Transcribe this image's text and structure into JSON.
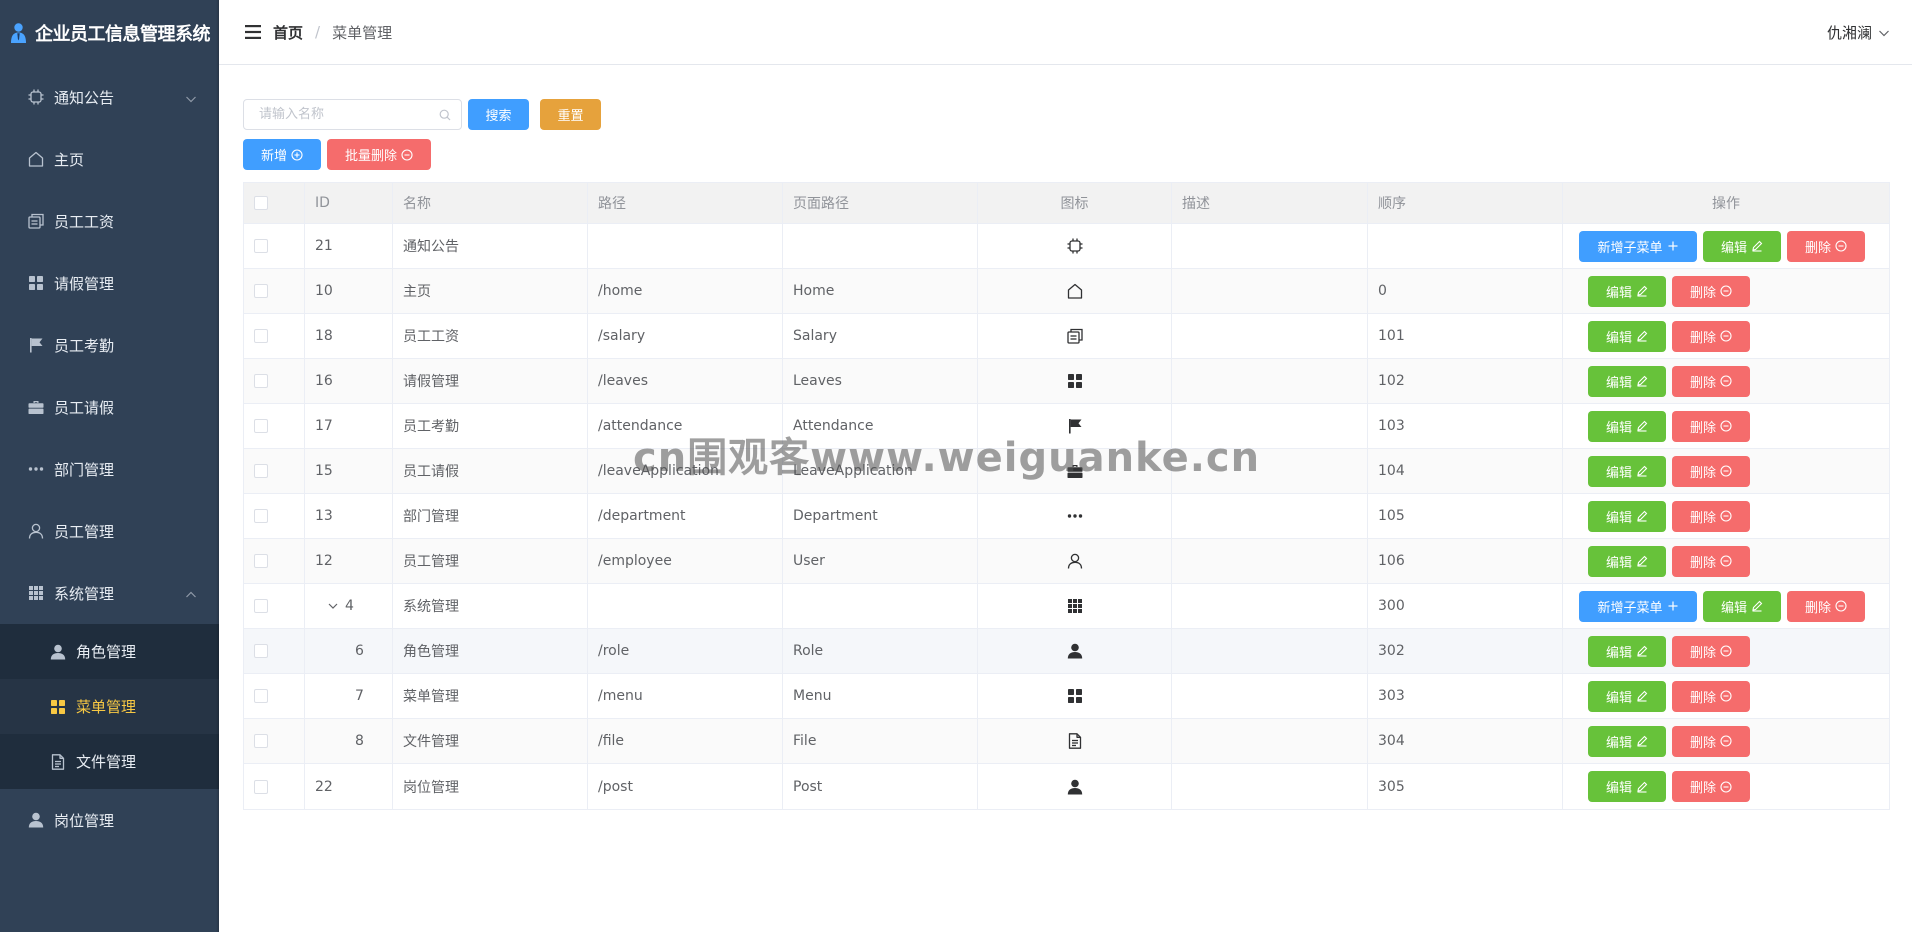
{
  "app": {
    "title": "企业员工信息管理系统"
  },
  "sidebar": {
    "items": [
      {
        "label": "通知公告",
        "icon": "cpu-icon",
        "arrow": "down"
      },
      {
        "label": "主页",
        "icon": "house-icon"
      },
      {
        "label": "员工工资",
        "icon": "tickets-icon"
      },
      {
        "label": "请假管理",
        "icon": "menu-grid-icon"
      },
      {
        "label": "员工考勤",
        "icon": "flag-icon"
      },
      {
        "label": "员工请假",
        "icon": "suitcase-icon"
      },
      {
        "label": "部门管理",
        "icon": "more-icon"
      },
      {
        "label": "员工管理",
        "icon": "user-icon"
      },
      {
        "label": "系统管理",
        "icon": "grid-icon",
        "arrow": "up"
      }
    ],
    "submenu": [
      {
        "label": "角色管理",
        "icon": "user-solid-icon"
      },
      {
        "label": "菜单管理",
        "icon": "menu-grid-icon",
        "active": true
      },
      {
        "label": "文件管理",
        "icon": "document-icon"
      }
    ],
    "last_item": {
      "label": "岗位管理",
      "icon": "user-solid-icon"
    }
  },
  "header": {
    "breadcrumb": {
      "home": "首页",
      "separator": "/",
      "current": "菜单管理"
    },
    "user": "仇湘澜"
  },
  "toolbar": {
    "search_placeholder": "请输入名称",
    "search_value": "",
    "search_label": "搜索",
    "reset_label": "重置",
    "add_label": "新增",
    "batch_delete_label": "批量删除"
  },
  "table": {
    "columns": [
      "ID",
      "名称",
      "路径",
      "页面路径",
      "图标",
      "描述",
      "顺序",
      "操作"
    ],
    "rows": [
      {
        "id": "21",
        "name": "通知公告",
        "path": "",
        "page": "",
        "icon": "cpu-icon",
        "desc": "",
        "order": "",
        "has_children": true,
        "level": 0
      },
      {
        "id": "10",
        "name": "主页",
        "path": "/home",
        "page": "Home",
        "icon": "house-icon",
        "desc": "",
        "order": "0",
        "level": 0
      },
      {
        "id": "18",
        "name": "员工工资",
        "path": "/salary",
        "page": "Salary",
        "icon": "tickets-icon",
        "desc": "",
        "order": "101",
        "level": 0
      },
      {
        "id": "16",
        "name": "请假管理",
        "path": "/leaves",
        "page": "Leaves",
        "icon": "menu-grid-icon",
        "desc": "",
        "order": "102",
        "level": 0
      },
      {
        "id": "17",
        "name": "员工考勤",
        "path": "/attendance",
        "page": "Attendance",
        "icon": "flag-icon",
        "desc": "",
        "order": "103",
        "level": 0
      },
      {
        "id": "15",
        "name": "员工请假",
        "path": "/leaveApplication",
        "page": "LeaveApplication",
        "icon": "suitcase-icon",
        "desc": "",
        "order": "104",
        "level": 0
      },
      {
        "id": "13",
        "name": "部门管理",
        "path": "/department",
        "page": "Department",
        "icon": "more-icon",
        "desc": "",
        "order": "105",
        "level": 0
      },
      {
        "id": "12",
        "name": "员工管理",
        "path": "/employee",
        "page": "User",
        "icon": "user-icon",
        "desc": "",
        "order": "106",
        "level": 0
      },
      {
        "id": "4",
        "name": "系统管理",
        "path": "",
        "page": "",
        "icon": "grid-icon",
        "desc": "",
        "order": "300",
        "has_children": true,
        "expanded": true,
        "level": 0
      },
      {
        "id": "6",
        "name": "角色管理",
        "path": "/role",
        "page": "Role",
        "icon": "user-solid-icon",
        "desc": "",
        "order": "302",
        "level": 1
      },
      {
        "id": "7",
        "name": "菜单管理",
        "path": "/menu",
        "page": "Menu",
        "icon": "menu-grid-icon",
        "desc": "",
        "order": "303",
        "level": 1
      },
      {
        "id": "8",
        "name": "文件管理",
        "path": "/file",
        "page": "File",
        "icon": "document-icon",
        "desc": "",
        "order": "304",
        "level": 1
      },
      {
        "id": "22",
        "name": "岗位管理",
        "path": "/post",
        "page": "Post",
        "icon": "user-solid-icon",
        "desc": "",
        "order": "305",
        "level": 0
      }
    ],
    "ops": {
      "add_child": "新增子菜单",
      "edit": "编辑",
      "delete": "删除"
    }
  },
  "watermark": "cn围观客www.weiguanke.cn",
  "colors": {
    "sidebar": "#304156",
    "primary": "#409eff",
    "success": "#67c23a",
    "danger": "#f56c6c",
    "warning": "#e6a23c",
    "active": "#f7c843"
  }
}
